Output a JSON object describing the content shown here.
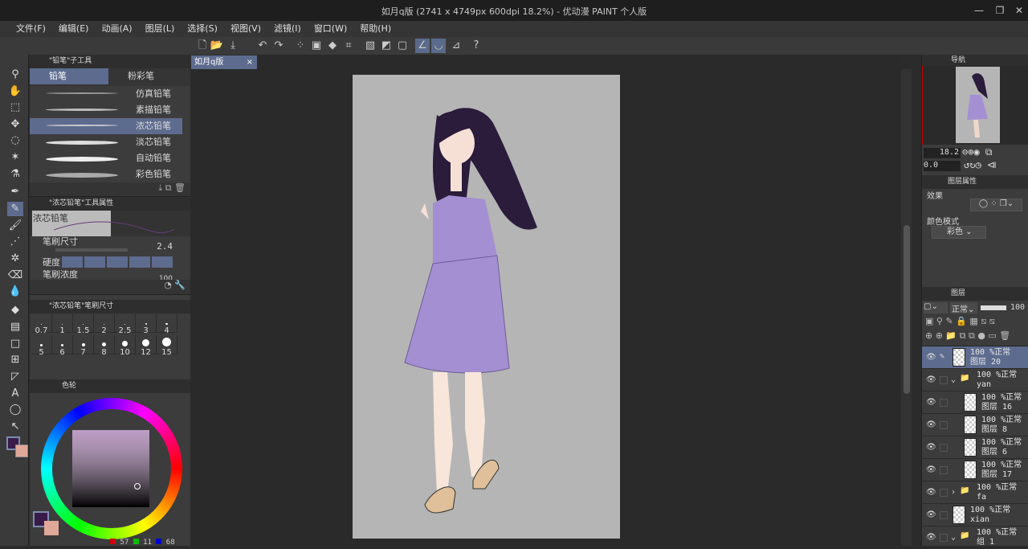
{
  "title": "如月q版 (2741 x 4749px 600dpi 18.2%) - 优动漫 PAINT 个人版",
  "menu": [
    "文件(F)",
    "编辑(E)",
    "动画(A)",
    "图层(L)",
    "选择(S)",
    "视图(V)",
    "滤镜(I)",
    "窗口(W)",
    "帮助(H)"
  ],
  "subtool": {
    "header": "\"铅笔\"子工具",
    "tabs": [
      "铅笔",
      "粉彩笔"
    ],
    "brushes": [
      "仿真铅笔",
      "素描铅笔",
      "浓芯铅笔",
      "淡芯铅笔",
      "自动铅笔",
      "彩色铅笔"
    ],
    "selected": 2
  },
  "toolprop": {
    "header": "\"浓芯铅笔\"工具属性",
    "preview": "浓芯铅笔",
    "size_label": "笔刷尺寸",
    "size_value": "2.4",
    "hardness_label": "硬度",
    "density_label": "笔刷浓度",
    "density_value": "100"
  },
  "brushsize": {
    "header": "\"浓芯铅笔\"笔刷尺寸",
    "sizes": [
      "0.7",
      "1",
      "1.5",
      "2",
      "2.5",
      "3",
      "4",
      "5",
      "6",
      "7",
      "8",
      "10",
      "12",
      "15"
    ]
  },
  "colorwheel": {
    "tab": "色轮",
    "main_color": "#3a1a48",
    "sub_color": "#e0a898",
    "r": "57",
    "g": "11",
    "b": "68"
  },
  "document": {
    "tab": "如月q版"
  },
  "navigator": {
    "tab": "导航",
    "zoom": "18.2",
    "rotate": "0.0"
  },
  "layerprop": {
    "tab": "图层属性",
    "effect": "效果",
    "colormode": "颜色模式",
    "colormode_value": "彩色"
  },
  "layers": {
    "tab": "图层",
    "blend": "正常",
    "opacity": "100",
    "items": [
      {
        "op": "100 %正常",
        "name": "图层 20",
        "indent": 0,
        "type": "layer",
        "sel": true
      },
      {
        "op": "100 %正常",
        "name": "yan",
        "indent": 0,
        "type": "folder-open"
      },
      {
        "op": "100 %正常",
        "name": "图层 16",
        "indent": 1,
        "type": "layer"
      },
      {
        "op": "100 %正常",
        "name": "图层 8",
        "indent": 1,
        "type": "layer"
      },
      {
        "op": "100 %正常",
        "name": "图层 6",
        "indent": 1,
        "type": "layer"
      },
      {
        "op": "100 %正常",
        "name": "图层 17",
        "indent": 1,
        "type": "layer"
      },
      {
        "op": "100 %正常",
        "name": "fa",
        "indent": 0,
        "type": "folder"
      },
      {
        "op": "100 %正常",
        "name": "xian",
        "indent": 0,
        "type": "layer-plain"
      },
      {
        "op": "100 %正常",
        "name": "组 1",
        "indent": 0,
        "type": "folder-open"
      }
    ]
  }
}
